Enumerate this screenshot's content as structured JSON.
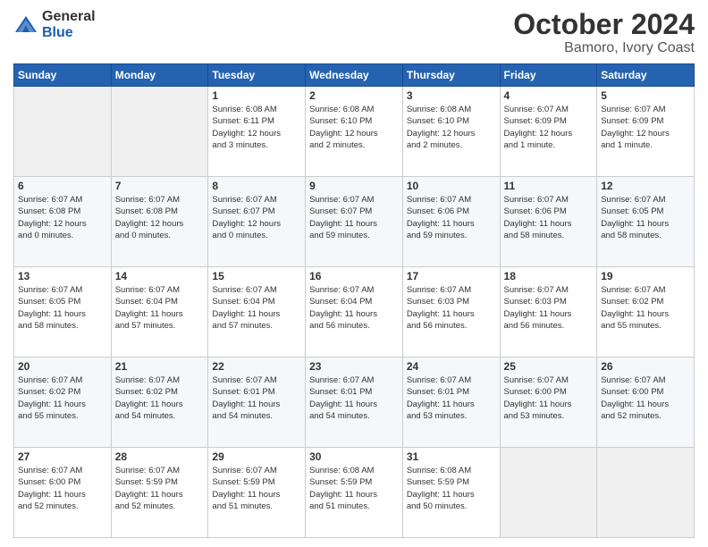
{
  "logo": {
    "general": "General",
    "blue": "Blue"
  },
  "title": "October 2024",
  "subtitle": "Bamoro, Ivory Coast",
  "days_header": [
    "Sunday",
    "Monday",
    "Tuesday",
    "Wednesday",
    "Thursday",
    "Friday",
    "Saturday"
  ],
  "weeks": [
    [
      {
        "num": "",
        "info": ""
      },
      {
        "num": "",
        "info": ""
      },
      {
        "num": "1",
        "info": "Sunrise: 6:08 AM\nSunset: 6:11 PM\nDaylight: 12 hours\nand 3 minutes."
      },
      {
        "num": "2",
        "info": "Sunrise: 6:08 AM\nSunset: 6:10 PM\nDaylight: 12 hours\nand 2 minutes."
      },
      {
        "num": "3",
        "info": "Sunrise: 6:08 AM\nSunset: 6:10 PM\nDaylight: 12 hours\nand 2 minutes."
      },
      {
        "num": "4",
        "info": "Sunrise: 6:07 AM\nSunset: 6:09 PM\nDaylight: 12 hours\nand 1 minute."
      },
      {
        "num": "5",
        "info": "Sunrise: 6:07 AM\nSunset: 6:09 PM\nDaylight: 12 hours\nand 1 minute."
      }
    ],
    [
      {
        "num": "6",
        "info": "Sunrise: 6:07 AM\nSunset: 6:08 PM\nDaylight: 12 hours\nand 0 minutes."
      },
      {
        "num": "7",
        "info": "Sunrise: 6:07 AM\nSunset: 6:08 PM\nDaylight: 12 hours\nand 0 minutes."
      },
      {
        "num": "8",
        "info": "Sunrise: 6:07 AM\nSunset: 6:07 PM\nDaylight: 12 hours\nand 0 minutes."
      },
      {
        "num": "9",
        "info": "Sunrise: 6:07 AM\nSunset: 6:07 PM\nDaylight: 11 hours\nand 59 minutes."
      },
      {
        "num": "10",
        "info": "Sunrise: 6:07 AM\nSunset: 6:06 PM\nDaylight: 11 hours\nand 59 minutes."
      },
      {
        "num": "11",
        "info": "Sunrise: 6:07 AM\nSunset: 6:06 PM\nDaylight: 11 hours\nand 58 minutes."
      },
      {
        "num": "12",
        "info": "Sunrise: 6:07 AM\nSunset: 6:05 PM\nDaylight: 11 hours\nand 58 minutes."
      }
    ],
    [
      {
        "num": "13",
        "info": "Sunrise: 6:07 AM\nSunset: 6:05 PM\nDaylight: 11 hours\nand 58 minutes."
      },
      {
        "num": "14",
        "info": "Sunrise: 6:07 AM\nSunset: 6:04 PM\nDaylight: 11 hours\nand 57 minutes."
      },
      {
        "num": "15",
        "info": "Sunrise: 6:07 AM\nSunset: 6:04 PM\nDaylight: 11 hours\nand 57 minutes."
      },
      {
        "num": "16",
        "info": "Sunrise: 6:07 AM\nSunset: 6:04 PM\nDaylight: 11 hours\nand 56 minutes."
      },
      {
        "num": "17",
        "info": "Sunrise: 6:07 AM\nSunset: 6:03 PM\nDaylight: 11 hours\nand 56 minutes."
      },
      {
        "num": "18",
        "info": "Sunrise: 6:07 AM\nSunset: 6:03 PM\nDaylight: 11 hours\nand 56 minutes."
      },
      {
        "num": "19",
        "info": "Sunrise: 6:07 AM\nSunset: 6:02 PM\nDaylight: 11 hours\nand 55 minutes."
      }
    ],
    [
      {
        "num": "20",
        "info": "Sunrise: 6:07 AM\nSunset: 6:02 PM\nDaylight: 11 hours\nand 55 minutes."
      },
      {
        "num": "21",
        "info": "Sunrise: 6:07 AM\nSunset: 6:02 PM\nDaylight: 11 hours\nand 54 minutes."
      },
      {
        "num": "22",
        "info": "Sunrise: 6:07 AM\nSunset: 6:01 PM\nDaylight: 11 hours\nand 54 minutes."
      },
      {
        "num": "23",
        "info": "Sunrise: 6:07 AM\nSunset: 6:01 PM\nDaylight: 11 hours\nand 54 minutes."
      },
      {
        "num": "24",
        "info": "Sunrise: 6:07 AM\nSunset: 6:01 PM\nDaylight: 11 hours\nand 53 minutes."
      },
      {
        "num": "25",
        "info": "Sunrise: 6:07 AM\nSunset: 6:00 PM\nDaylight: 11 hours\nand 53 minutes."
      },
      {
        "num": "26",
        "info": "Sunrise: 6:07 AM\nSunset: 6:00 PM\nDaylight: 11 hours\nand 52 minutes."
      }
    ],
    [
      {
        "num": "27",
        "info": "Sunrise: 6:07 AM\nSunset: 6:00 PM\nDaylight: 11 hours\nand 52 minutes."
      },
      {
        "num": "28",
        "info": "Sunrise: 6:07 AM\nSunset: 5:59 PM\nDaylight: 11 hours\nand 52 minutes."
      },
      {
        "num": "29",
        "info": "Sunrise: 6:07 AM\nSunset: 5:59 PM\nDaylight: 11 hours\nand 51 minutes."
      },
      {
        "num": "30",
        "info": "Sunrise: 6:08 AM\nSunset: 5:59 PM\nDaylight: 11 hours\nand 51 minutes."
      },
      {
        "num": "31",
        "info": "Sunrise: 6:08 AM\nSunset: 5:59 PM\nDaylight: 11 hours\nand 50 minutes."
      },
      {
        "num": "",
        "info": ""
      },
      {
        "num": "",
        "info": ""
      }
    ]
  ]
}
